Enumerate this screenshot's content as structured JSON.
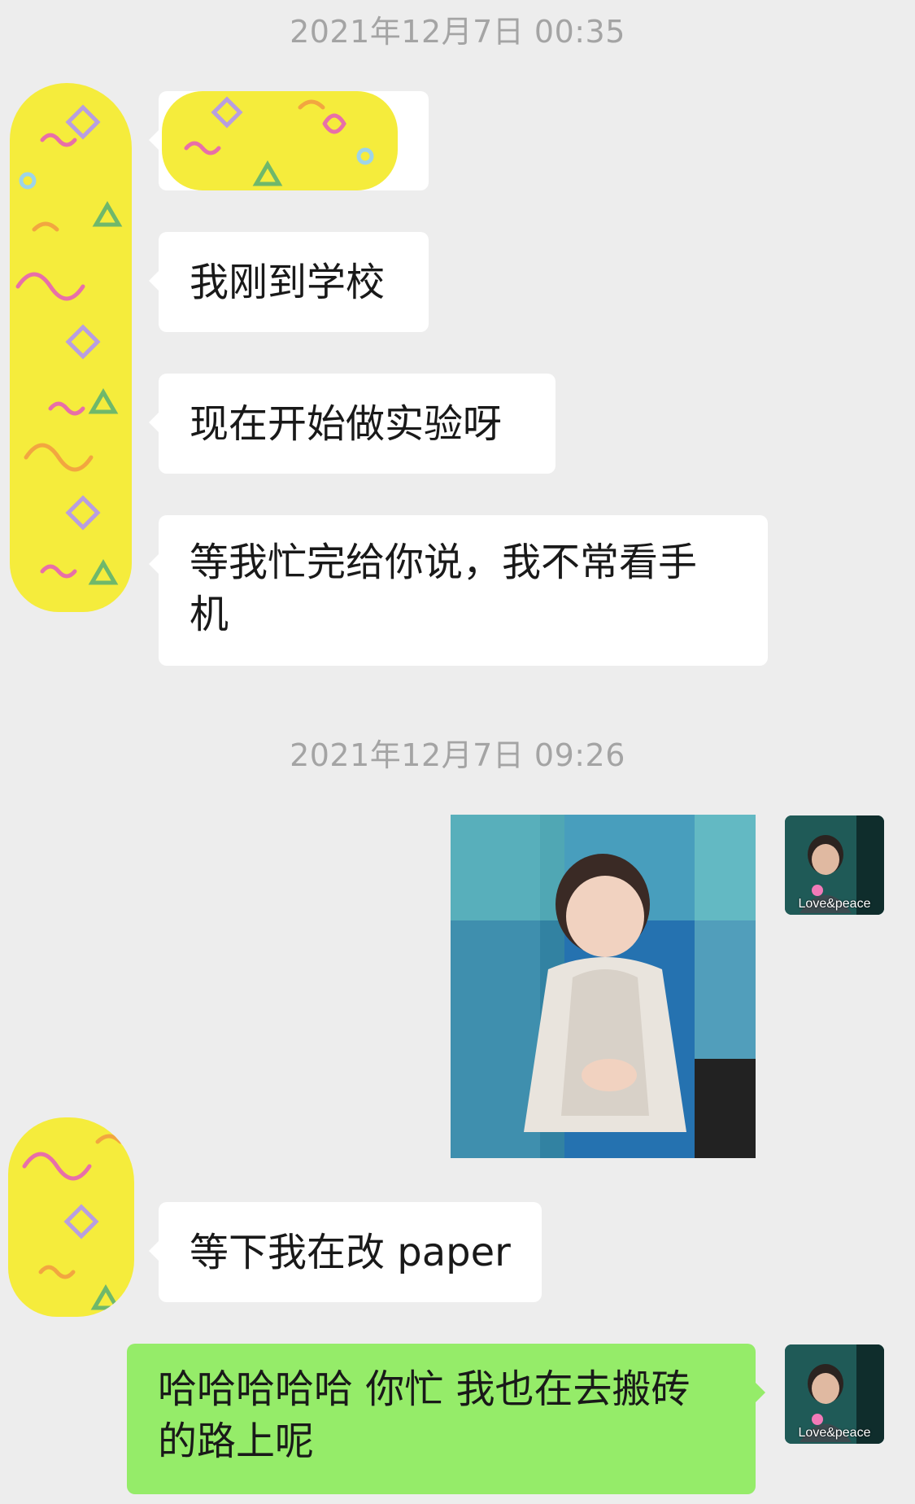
{
  "timestamps": [
    "2021年12月7日 00:35",
    "2021年12月7日 09:26"
  ],
  "messages": {
    "m1": "我刚到学校",
    "m2": "现在开始做实验呀",
    "m3_line1": "等我忙完给你说，我不常看手",
    "m3_line2": "机",
    "m4": "等下我在改 paper",
    "m5_line1": "哈哈哈哈哈 你忙 我也在去搬砖",
    "m5_line2": "的路上呢"
  },
  "avatar": {
    "caption": "Love&peace"
  },
  "colors": {
    "background": "#ededed",
    "incoming_bubble": "#ffffff",
    "outgoing_bubble": "#95ec69",
    "timestamp_text": "#a4a4a4",
    "redaction_yellow": "#f5ec3c"
  },
  "icons": [
    "redaction-scribble",
    "contact-avatar",
    "sticker-photo"
  ]
}
